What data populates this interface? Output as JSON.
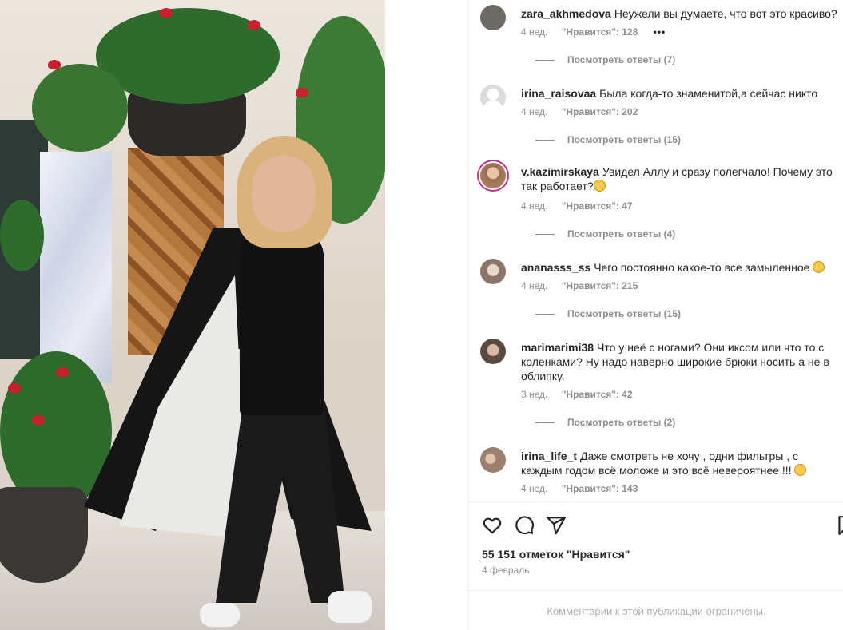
{
  "comments": [
    {
      "username": "zara_akhmedova",
      "text": "Неужели вы думаете, что вот это красиво?",
      "time": "4 нед.",
      "likes": "\"Нравится\": 128",
      "more": "•••",
      "replies": "Посмотреть ответы (7)",
      "avatar_color": "#6d6a66"
    },
    {
      "username": "irina_raisovaa",
      "text": "Была когда-то знаменитой,а сейчас никто",
      "time": "4 нед.",
      "likes": "\"Нравится\": 202",
      "replies": "Посмотреть ответы (15)",
      "avatar_color": "#dbdbdb"
    },
    {
      "username": "v.kazimirskaya",
      "text": "Увидел Аллу и сразу полегчало! Почему это так работает?",
      "time": "4 нед.",
      "likes": "\"Нравится\": 47",
      "replies": "Посмотреть ответы (4)",
      "avatar_color": "#b78a6a"
    },
    {
      "username": "ananasss_ss",
      "text": "Чего постоянно какое-то все замыленное",
      "time": "4 нед.",
      "likes": "\"Нравится\": 215",
      "replies": "Посмотреть ответы (15)",
      "avatar_color": "#8a7566"
    },
    {
      "username": "marimarimi38",
      "text": "Что у неё с ногами? Они иксом или что то с коленками? Ну надо наверно широкие брюки носить а не в облипку.",
      "time": "3 нед.",
      "likes": "\"Нравится\": 42",
      "replies": "Посмотреть ответы (2)",
      "avatar_color": "#5b4a40"
    },
    {
      "username": "irina_life_t",
      "text": "Даже смотреть не хочу , одни фильтры , с каждым годом всё моложе и это всё невероятнее !!!",
      "time": "4 нед.",
      "likes": "\"Нравится\": 143",
      "avatar_color": "#9c7f6e"
    }
  ],
  "post": {
    "likes_count": "55 151 отметок \"Нравится\"",
    "date": "4 февраль",
    "comments_limited": "Комментарии к этой публикации ограничены."
  },
  "icons": {
    "like": "heart-icon",
    "comment": "comment-icon",
    "share": "share-icon",
    "save": "bookmark-icon"
  }
}
